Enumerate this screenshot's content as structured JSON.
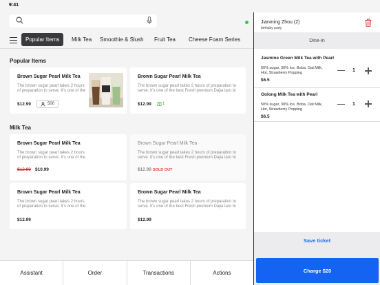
{
  "status": {
    "time": "9:41"
  },
  "search": {
    "placeholder": ""
  },
  "categories": [
    "Popular Items",
    "Milk Tea",
    "Smoothie  & Slush",
    "Fruit Tea",
    "Cheese Foam Series"
  ],
  "sections": {
    "popular": "Popular Items",
    "milk_tea": "Milk Tea"
  },
  "cards": [
    {
      "title": "Brown Sugar Pearl Milk Tea",
      "desc": "The brown sugar pearl takes 2 hours of preparation to serve. It's one of the",
      "price": "$12.99",
      "stock": "500"
    },
    {
      "title": "Brown Sugar Pearl Milk Tea",
      "desc": "The brown sugar pearl takes 2 hours of preparation to serve. It's one of the best Fresh premium Dajia taro bi",
      "price": "$12.99",
      "gift": "1"
    },
    {
      "title": "Brown Sugar Pearl Milk Tea",
      "desc": "The brown sugar pearl takes 2 hours of preparation to serve. It's one of the",
      "price_old": "$12.99",
      "price": "$10.99"
    },
    {
      "title": "Brown Sugar Pearl Milk Tea",
      "desc": "The brown sugar pearl takes 2 hours of preparation to serve. It's one of the best Fresh premium Dajia taro bi",
      "price": "$12.99",
      "soldout": "SOLD OUT"
    },
    {
      "title": "Brown Sugar Pearl Milk Tea",
      "desc": "The brown sugar pearl takes 2 hours of preparation to serve. It's one of the",
      "price": "$12.99"
    },
    {
      "title": "Brown Sugar Pearl Milk Tea",
      "desc": "The brown sugar pearl takes 2 hours of preparation to serve. It's one of the best Fresh premium Dajia taro bi",
      "price": "$12.99"
    }
  ],
  "bottom_nav": [
    "Assistant",
    "Order",
    "Transactions",
    "Actions"
  ],
  "ticket": {
    "customer": "Jianming Zhou (2)",
    "note": "birthday party",
    "dining": "Dine-In",
    "items": [
      {
        "name": "Jasmine Green Milk Tea with Pearl",
        "mods": "50% sugar, 30% Ice, Boba, Oat Milk, Hot, Strawberry Popping",
        "price": "$6.5",
        "qty": "1"
      },
      {
        "name": "Oolong Milk Tea with Pearl",
        "mods": "50% sugar, 30% Ice, Boba, Oat Milk, Hot, Strawberry Popping",
        "price": "$6.5",
        "qty": "1"
      }
    ],
    "save_label": "Save ticket",
    "charge_label": "Charge  $20"
  },
  "colors": {
    "accent": "#1463f3",
    "sold_out": "#e53935",
    "online": "#2ecc40"
  }
}
